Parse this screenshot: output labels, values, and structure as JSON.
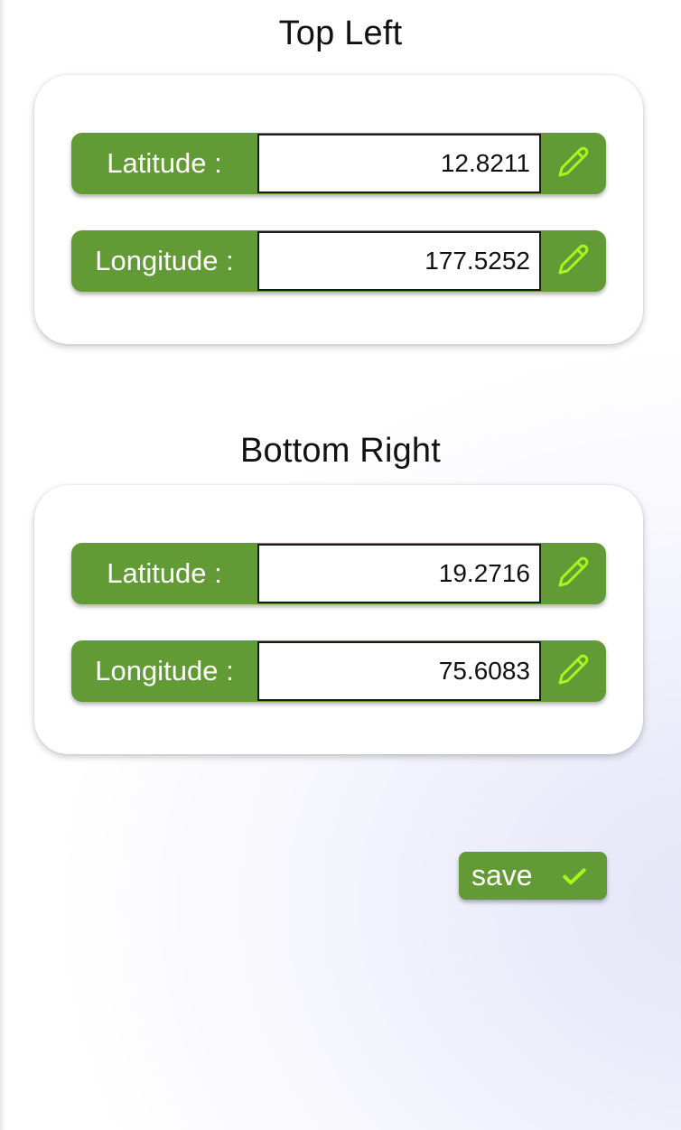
{
  "sections": {
    "top_left": {
      "title": "Top Left",
      "latitude": {
        "label": "Latitude :",
        "value": "12.8211"
      },
      "longitude": {
        "label": "Longitude :",
        "value": "177.5252"
      }
    },
    "bottom_right": {
      "title": "Bottom Right",
      "latitude": {
        "label": "Latitude :",
        "value": "19.2716"
      },
      "longitude": {
        "label": "Longitude :",
        "value": "75.6083"
      }
    }
  },
  "actions": {
    "save_label": "save"
  },
  "icons": {
    "edit": "pencil-icon",
    "save": "check-icon"
  },
  "colors": {
    "accent_green": "#629a35",
    "icon_lime": "#a6f51e",
    "text_dark": "#111111"
  }
}
